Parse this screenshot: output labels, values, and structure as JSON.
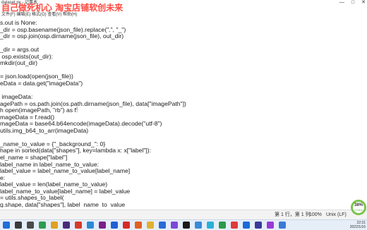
{
  "window": {
    "title": "dataset.py - 记事本",
    "minimize": "—",
    "maximize": "□",
    "close": "✕"
  },
  "watermark": "自己做死机心 淘宝店铺软创未来",
  "menubar": "文件(F)  编辑(E)  格式(O)  查看(V)  帮助(H)",
  "editor": {
    "lines": [
      "s.out is None:",
      "_dir = osp.basename(json_file).replace(\".\", \"_\")",
      "_dir = osp.join(osp.dirname(json_file), out_dir)",
      "",
      "_dir = args.out",
      " osp.exists(out_dir):",
      "mkdir(out_dir)",
      "",
      "= json.load(open(json_file))",
      "eData = data.get(\"imageData\")",
      "",
      " imageData:",
      "agePath = os.path.join(os.path.dirname(json_file), data[\"imagePath\"])",
      "h open(imagePath, \"rb\") as f:",
      "mageData = f.read()",
      "mageData = base64.b64encode(imageData).decode(\"utf-8\")",
      "utils.img_b64_to_arr(imageData)",
      "",
      "_name_to_value = {\"_background_\": 0}",
      "hape in sorted(data[\"shapes\"], key=lambda x: x[\"label\"]):",
      "el_name = shape[\"label\"]",
      "label_name in label_name_to_value:",
      "label_value = label_name_to_value[label_name]",
      "e:",
      "label_value = len(label_name_to_value)",
      "label_name_to_value[label_name] = label_value",
      "= utils.shapes_to_label(",
      "g.shape, data[\"shapes\"], label_name_to_value"
    ]
  },
  "statusbar": {
    "position": "第 1 行，第 1 列",
    "zoom": "100%",
    "eol": "Unix (LF)"
  },
  "perf_ring": {
    "value": "38%",
    "sub": "0.1K/s"
  },
  "taskbar": {
    "icons": [
      {
        "name": "windows-start-icon",
        "color": "#1f6fd6"
      },
      {
        "name": "search-icon",
        "color": "#3a3a3a"
      },
      {
        "name": "task-view-icon",
        "color": "#4a4a4a"
      },
      {
        "name": "browser-icon",
        "color": "#2e9b4f"
      },
      {
        "name": "chrome-icon",
        "color": "#e0a020"
      },
      {
        "name": "premiere-icon",
        "color": "#4a2b7a"
      },
      {
        "name": "app-icon",
        "color": "#d63a2a"
      },
      {
        "name": "photos-icon",
        "color": "#2a8ad6"
      },
      {
        "name": "app-icon",
        "color": "#7a1f8a"
      },
      {
        "name": "media-icon",
        "color": "#1f5fd6"
      },
      {
        "name": "app-icon",
        "color": "#d62a2a"
      },
      {
        "name": "app-icon",
        "color": "#e06020"
      },
      {
        "name": "file-explorer-icon",
        "color": "#e0b030"
      },
      {
        "name": "app-icon",
        "color": "#2a6ad6"
      },
      {
        "name": "visual-studio-icon",
        "color": "#7a4ad6"
      },
      {
        "name": "app-icon",
        "color": "#1a1a1a"
      },
      {
        "name": "app-icon",
        "color": "#3a8ad6"
      },
      {
        "name": "app-icon",
        "color": "#2ab0d6"
      },
      {
        "name": "app-icon",
        "color": "#2a9a4a"
      },
      {
        "name": "app-icon",
        "color": "#e03a3a"
      },
      {
        "name": "app-icon",
        "color": "#1a6ad6"
      },
      {
        "name": "app-icon",
        "color": "#3a3a9a"
      },
      {
        "name": "app-icon",
        "color": "#9a3ad6"
      },
      {
        "name": "notepad-icon",
        "color": "#3a7ad6"
      }
    ],
    "clock_time": "22:31",
    "clock_date": "2022/1/16"
  }
}
